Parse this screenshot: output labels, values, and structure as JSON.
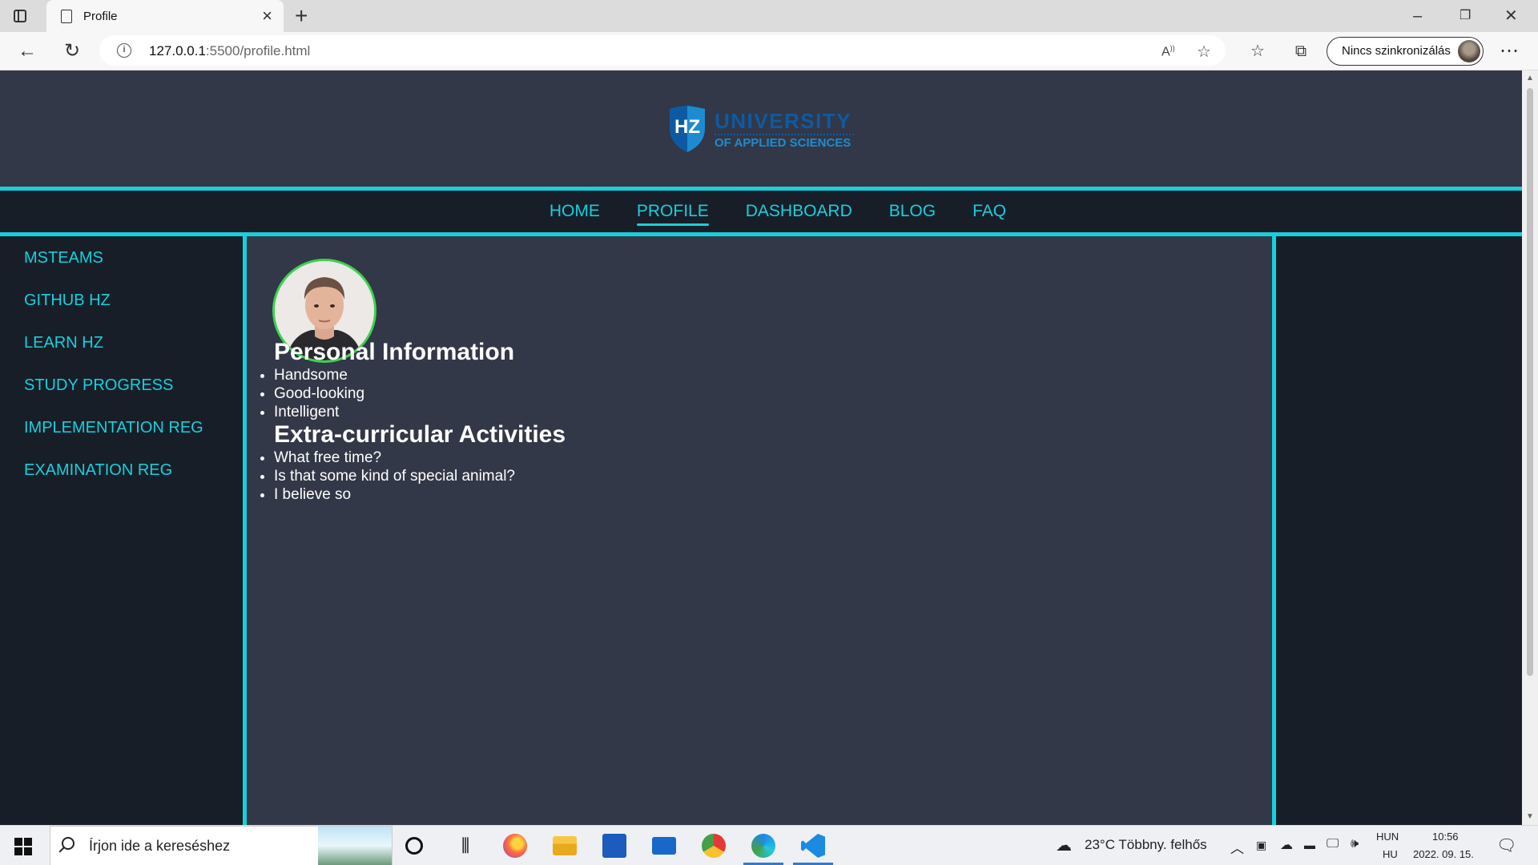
{
  "browser": {
    "tab_title": "Profile",
    "url_host": "127.0.0.1",
    "url_rest": ":5500/profile.html",
    "sync_label": "Nincs szinkronizálás",
    "icons": [
      "tab-actions-icon",
      "page-icon",
      "close-icon",
      "plus-icon",
      "minimize-icon",
      "restore-icon",
      "close-window-icon",
      "back-icon",
      "refresh-icon",
      "info-icon",
      "read-aloud-icon",
      "add-favorite-icon",
      "favorites-icon",
      "collections-icon",
      "more-icon"
    ]
  },
  "site": {
    "logo": {
      "mark": "HZ",
      "line1": "UNIVERSITY",
      "line2": "OF APPLIED SCIENCES"
    },
    "nav": [
      {
        "label": "HOME"
      },
      {
        "label": "PROFILE",
        "active": true
      },
      {
        "label": "DASHBOARD"
      },
      {
        "label": "BLOG"
      },
      {
        "label": "FAQ"
      }
    ],
    "sidebar": [
      {
        "label": "MSTEAMS"
      },
      {
        "label": "GITHUB HZ"
      },
      {
        "label": "LEARN HZ"
      },
      {
        "label": "STUDY PROGRESS"
      },
      {
        "label": "IMPLEMENTATION REG"
      },
      {
        "label": "EXAMINATION REG"
      }
    ],
    "profile": {
      "section1_title": "Personal Information",
      "section1_items": [
        "Handsome",
        "Good-looking",
        "Intelligent"
      ],
      "section2_title": "Extra-curricular Activities",
      "section2_items": [
        "What free time?",
        "Is that some kind of special animal?",
        "I believe so"
      ]
    },
    "colors": {
      "accent": "#17d0dc",
      "page_bg": "#323847",
      "dark_bg": "#181e28",
      "avatar_ring": "#3dd14e"
    }
  },
  "taskbar": {
    "search_placeholder": "Írjon ide a kereséshez",
    "weather": "23°C  Többny. felhős",
    "lang_top": "HUN",
    "lang_bottom": "HU",
    "time": "10:56",
    "date": "2022. 09. 15."
  }
}
